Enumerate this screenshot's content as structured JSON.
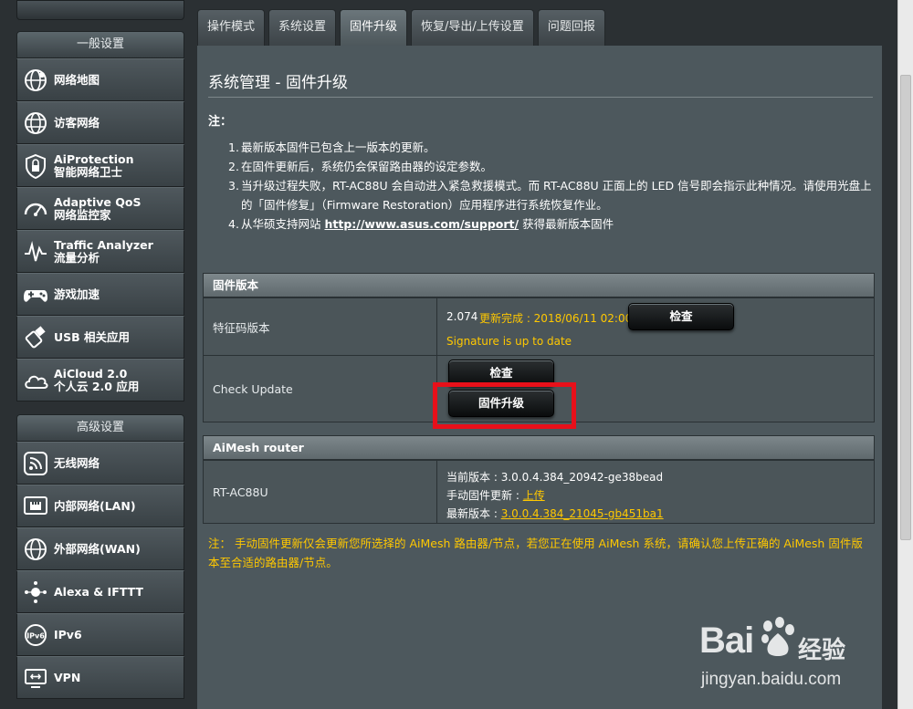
{
  "sidebar": {
    "general_header": "一般设置",
    "general_items": [
      {
        "icon": "globe-network-map-icon",
        "lines": [
          "网络地图"
        ]
      },
      {
        "icon": "guest-network-icon",
        "lines": [
          "访客网络"
        ]
      },
      {
        "icon": "shield-lock-icon",
        "lines": [
          "AiProtection",
          "智能网络卫士"
        ]
      },
      {
        "icon": "speed-gauge-icon",
        "lines": [
          "Adaptive QoS",
          "网络监控家"
        ]
      },
      {
        "icon": "traffic-wave-icon",
        "lines": [
          "Traffic Analyzer",
          "流量分析"
        ]
      },
      {
        "icon": "gamepad-icon",
        "lines": [
          "游戏加速"
        ]
      },
      {
        "icon": "usb-icon",
        "lines": [
          "USB 相关应用"
        ]
      },
      {
        "icon": "cloud-icon",
        "lines": [
          "AiCloud 2.0",
          "个人云 2.0 应用"
        ]
      }
    ],
    "advanced_header": "高级设置",
    "advanced_items": [
      {
        "icon": "wifi-icon",
        "lines": [
          "无线网络"
        ]
      },
      {
        "icon": "lan-port-icon",
        "lines": [
          "内部网络(LAN)"
        ]
      },
      {
        "icon": "wan-globe-icon",
        "lines": [
          "外部网络(WAN)"
        ]
      },
      {
        "icon": "alexa-ifttt-icon",
        "lines": [
          "Alexa & IFTTT"
        ]
      },
      {
        "icon": "ipv6-icon",
        "lines": [
          "IPv6"
        ]
      },
      {
        "icon": "vpn-icon",
        "lines": [
          "VPN"
        ]
      }
    ]
  },
  "tabs": [
    "操作模式",
    "系统设置",
    "固件升级",
    "恢复/导出/上传设置",
    "问题回报"
  ],
  "active_tab": 2,
  "page": {
    "title": "系统管理 - 固件升级",
    "note_label": "注：",
    "notes": [
      {
        "num": "1.",
        "text": "最新版本固件已包含上一版本的更新。"
      },
      {
        "num": "2.",
        "text": "在固件更新后，系统仍会保留路由器的设定参数。"
      },
      {
        "num": "3.",
        "text": "当升级过程失败，RT-AC88U 会自动进入紧急救援模式。而 RT-AC88U 正面上的 LED 信号即会指示此种情况。请使用光盘上的「固件修复」（Firmware Restoration）应用程序进行系统恢复作业。"
      },
      {
        "num": "4.",
        "text_before": "从华硕支持网站 ",
        "link": "http://www.asus.com/support/",
        "text_after": " 获得最新版本固件"
      }
    ]
  },
  "firmware_table": {
    "header": "固件版本",
    "row1_label": "特征码版本",
    "sig_version": "2.074",
    "sig_update_status": "更新完成 : 2018/06/11 02:00",
    "sig_status": "Signature is up to date",
    "check_button_1": "检查",
    "row2_label": "Check Update",
    "check_button_2": "检查",
    "upgrade_button": "固件升级"
  },
  "aimesh_table": {
    "header": "AiMesh router",
    "router_name": "RT-AC88U",
    "current_label": "当前版本 : ",
    "current_value": "3.0.0.4.384_20942-ge38bead",
    "manual_label": "手动固件更新 : ",
    "manual_link": "上传",
    "latest_label": "最新版本 : ",
    "latest_value": "3.0.0.4.384_21045-gb451ba1"
  },
  "warning": "注： 手动固件更新仅会更新您所选择的 AiMesh 路由器/节点，若您正在使用 AiMesh 系统，请确认您上传正确的 AiMesh 固件版本至合适的路由器/节点。",
  "watermark": {
    "brand": "Bai",
    "brand2": "经验",
    "url": "jingyan.baidu.com"
  },
  "colors": {
    "accent_yellow": "#ffc800",
    "highlight_red": "#e8101a",
    "panel": "#4d585d"
  }
}
